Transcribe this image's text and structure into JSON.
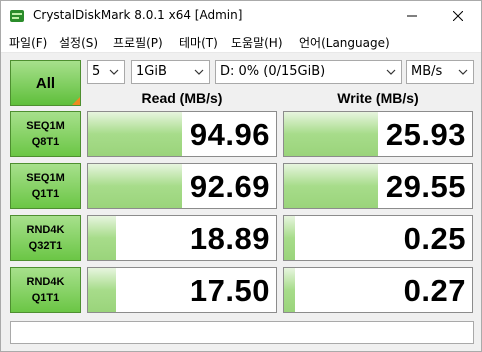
{
  "window": {
    "title": "CrystalDiskMark 8.0.1 x64 [Admin]",
    "minimize_label": "—",
    "close_label": "✕"
  },
  "menu": [
    {
      "label": "파일(F)"
    },
    {
      "label": "설정(S)"
    },
    {
      "label": "프로필(P)"
    },
    {
      "label": "테마(T)"
    },
    {
      "label": "도움말(H)"
    },
    {
      "label": "언어(Language)"
    }
  ],
  "controls": {
    "all_label": "All",
    "count": "5",
    "size": "1GiB",
    "drive": "D: 0% (0/15GiB)",
    "unit": "MB/s"
  },
  "headers": {
    "read": "Read (MB/s)",
    "write": "Write (MB/s)"
  },
  "tests": [
    {
      "line1": "SEQ1M",
      "line2": "Q8T1",
      "read": "94.96",
      "write": "25.93",
      "read_fill": 0.5,
      "write_fill": 0.5
    },
    {
      "line1": "SEQ1M",
      "line2": "Q1T1",
      "read": "92.69",
      "write": "29.55",
      "read_fill": 0.5,
      "write_fill": 0.5
    },
    {
      "line1": "RND4K",
      "line2": "Q32T1",
      "read": "18.89",
      "write": "0.25",
      "read_fill": 0.15,
      "write_fill": 0.06
    },
    {
      "line1": "RND4K",
      "line2": "Q1T1",
      "read": "17.50",
      "write": "0.27",
      "read_fill": 0.15,
      "write_fill": 0.06
    }
  ],
  "comment": "",
  "colors": {
    "button_green": "#6bc645",
    "bar_green": "#a7dc8a",
    "corner_orange": "#f08a1f"
  }
}
